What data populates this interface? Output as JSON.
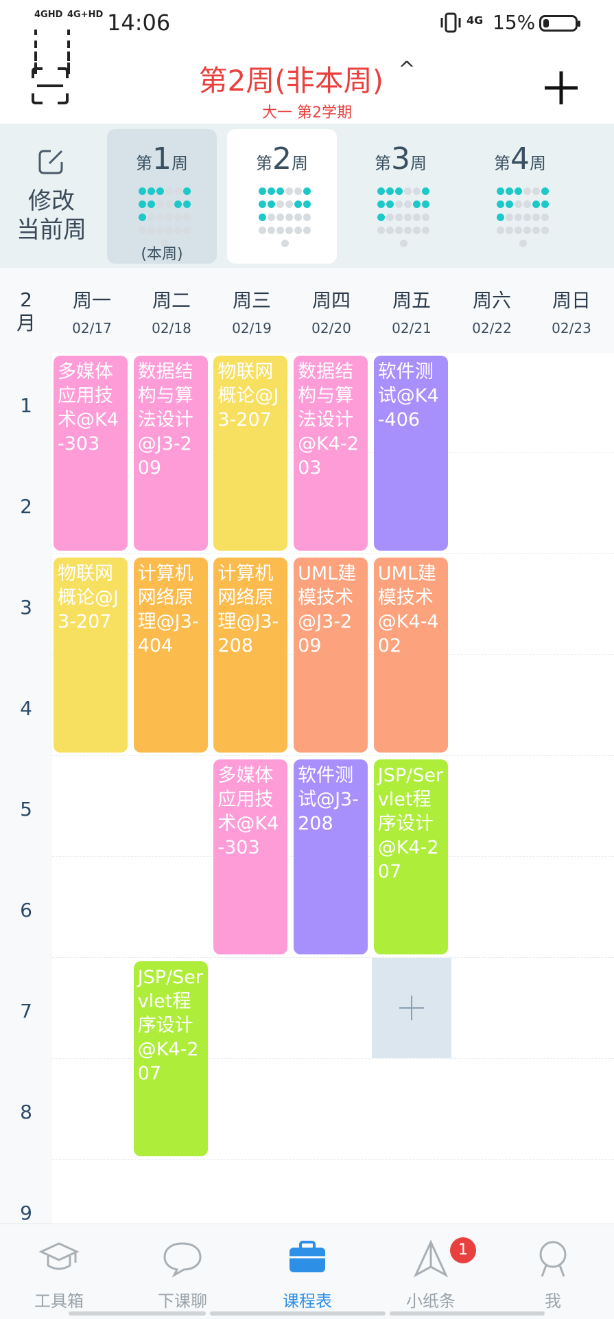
{
  "status_bar": {
    "signal1": "4GHD",
    "signal2": "4G+HD",
    "time": "14:06",
    "net": "4G",
    "battery": "15%"
  },
  "header": {
    "title": "第2周(非本周)",
    "caret": "^",
    "subtitle": "大一 第2学期"
  },
  "week_selector": {
    "edit_label_line1": "修改",
    "edit_label_line2": "当前周",
    "weeks": [
      {
        "prefix": "第",
        "num": "1",
        "suffix": "周",
        "note": "(本周)"
      },
      {
        "prefix": "第",
        "num": "2",
        "suffix": "周",
        "note": ""
      },
      {
        "prefix": "第",
        "num": "3",
        "suffix": "周",
        "note": ""
      },
      {
        "prefix": "第",
        "num": "4",
        "suffix": "周",
        "note": ""
      }
    ]
  },
  "day_header": {
    "month_num": "2",
    "month_unit": "月",
    "days": [
      {
        "name": "周一",
        "date": "02/17"
      },
      {
        "name": "周二",
        "date": "02/18"
      },
      {
        "name": "周三",
        "date": "02/19"
      },
      {
        "name": "周四",
        "date": "02/20"
      },
      {
        "name": "周五",
        "date": "02/21"
      },
      {
        "name": "周六",
        "date": "02/22"
      },
      {
        "name": "周日",
        "date": "02/23"
      }
    ]
  },
  "periods": [
    "1",
    "2",
    "3",
    "4",
    "5",
    "6",
    "7",
    "8",
    "9"
  ],
  "courses": [
    {
      "day": 1,
      "start": 1,
      "end": 2,
      "color": "#fe9cd8",
      "text": "多媒体应用技术@K4-303"
    },
    {
      "day": 2,
      "start": 1,
      "end": 2,
      "color": "#fe9cd8",
      "text": "数据结构与算法设计@J3-209"
    },
    {
      "day": 3,
      "start": 1,
      "end": 2,
      "color": "#f7df5f",
      "text": "物联网概论@J3-207"
    },
    {
      "day": 4,
      "start": 1,
      "end": 2,
      "color": "#fe9cd8",
      "text": "数据结构与算法设计@K4-203"
    },
    {
      "day": 5,
      "start": 1,
      "end": 2,
      "color": "#a78ffc",
      "text": "软件测试@K4-406"
    },
    {
      "day": 1,
      "start": 3,
      "end": 4,
      "color": "#f7df5f",
      "text": "物联网概论@J3-207"
    },
    {
      "day": 2,
      "start": 3,
      "end": 4,
      "color": "#fcbb4d",
      "text": "计算机网络原理@J3-404"
    },
    {
      "day": 3,
      "start": 3,
      "end": 4,
      "color": "#fcbb4d",
      "text": "计算机网络原理@J3-208"
    },
    {
      "day": 4,
      "start": 3,
      "end": 4,
      "color": "#fca37d",
      "text": "UML建模技术@J3-209"
    },
    {
      "day": 5,
      "start": 3,
      "end": 4,
      "color": "#fca37d",
      "text": "UML建模技术@K4-402"
    },
    {
      "day": 3,
      "start": 5,
      "end": 6,
      "color": "#fe9cd8",
      "text": "多媒体应用技术@K4-303"
    },
    {
      "day": 4,
      "start": 5,
      "end": 6,
      "color": "#a78ffc",
      "text": "软件测试@J3-208"
    },
    {
      "day": 5,
      "start": 5,
      "end": 6,
      "color": "#aeed3a",
      "text": "JSP/Servlet程序设计@K4-207"
    },
    {
      "day": 2,
      "start": 7,
      "end": 8,
      "color": "#aeed3a",
      "text": "JSP/Servlet程序设计@K4-207"
    }
  ],
  "bottom_nav": {
    "items": [
      {
        "label": "工具箱",
        "icon": "graduation-cap-icon"
      },
      {
        "label": "下课聊",
        "icon": "chat-bubble-icon"
      },
      {
        "label": "课程表",
        "icon": "briefcase-icon"
      },
      {
        "label": "小纸条",
        "icon": "paper-plane-icon"
      },
      {
        "label": "我",
        "icon": "person-icon"
      }
    ],
    "active": "课程表",
    "badge": "1"
  },
  "colors": {
    "accent_red": "#e8403e",
    "accent_blue": "#2d8fe6",
    "week_dot": "#1cc8c8"
  }
}
